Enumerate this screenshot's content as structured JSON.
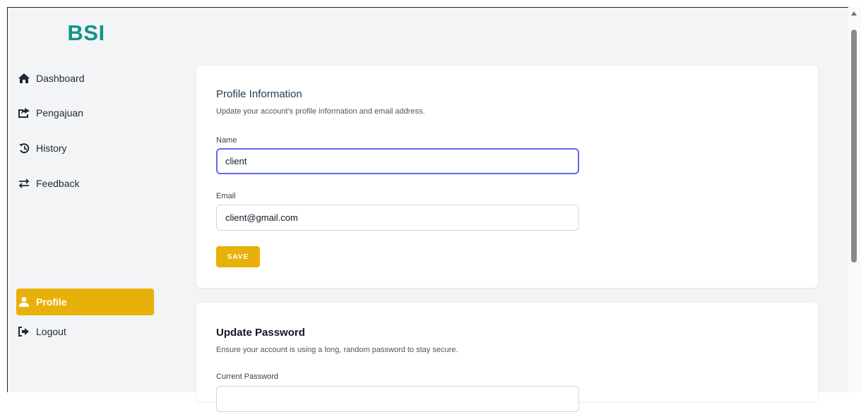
{
  "app": {
    "brand": "BSI"
  },
  "sidebar": {
    "items": [
      {
        "label": "Dashboard",
        "icon": "home-icon"
      },
      {
        "label": "Pengajuan",
        "icon": "share-icon"
      },
      {
        "label": "History",
        "icon": "history-icon"
      },
      {
        "label": "Feedback",
        "icon": "exchange-icon"
      }
    ],
    "profile_label": "Profile",
    "logout_label": "Logout"
  },
  "profile_card": {
    "title": "Profile Information",
    "description": "Update your account's profile information and email address.",
    "name_label": "Name",
    "name_value": "client",
    "email_label": "Email",
    "email_value": "client@gmail.com",
    "save_label": "SAVE"
  },
  "password_card": {
    "title": "Update Password",
    "description": "Ensure your account is using a long, random password to stay secure.",
    "current_password_label": "Current Password",
    "current_password_value": ""
  },
  "colors": {
    "brand": "#0f9488",
    "accent": "#e8b10a",
    "focus": "#6366f1"
  }
}
